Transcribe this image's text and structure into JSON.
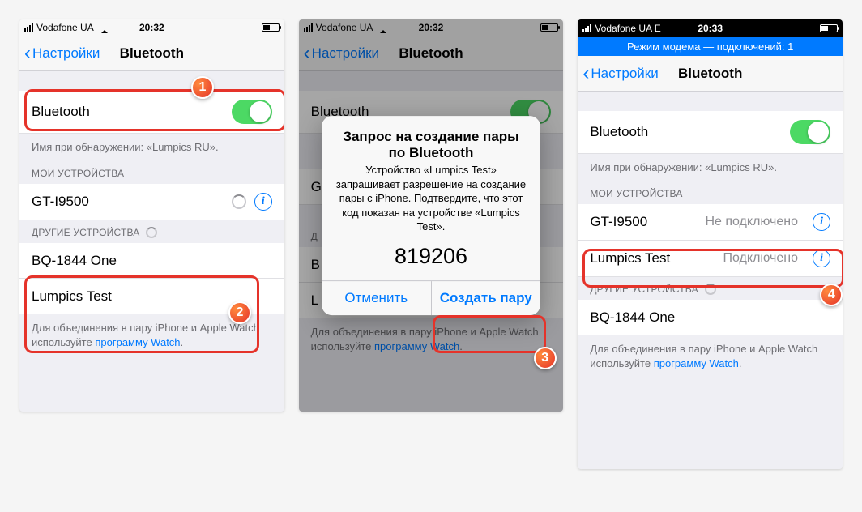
{
  "screen1": {
    "carrier": "Vodafone UA",
    "time": "20:32",
    "back": "Настройки",
    "title": "Bluetooth",
    "bt_label": "Bluetooth",
    "discoverable": "Имя при обнаружении: «Lumpics RU».",
    "my_devices_header": "МОИ УСТРОЙСТВА",
    "my_device": "GT-I9500",
    "other_devices_header": "ДРУГИЕ УСТРОЙСТВА",
    "other_device_1": "BQ-1844 One",
    "other_device_2": "Lumpics Test",
    "footer_a": "Для объединения в пару iPhone и Apple Watch используйте ",
    "footer_link": "программу Watch",
    "footer_b": "."
  },
  "screen2": {
    "carrier": "Vodafone UA",
    "time": "20:32",
    "back": "Настройки",
    "title": "Bluetooth",
    "alert_title": "Запрос на создание пары по Bluetooth",
    "alert_msg": "Устройство «Lumpics Test» запрашивает разрешение на создание пары с iPhone. Подтвердите, что этот код показан на устройстве «Lumpics Test».",
    "alert_code": "819206",
    "alert_cancel": "Отменить",
    "alert_confirm": "Создать пару",
    "footer_a": "Для объединения в пару iPhone и Apple Watch используйте ",
    "footer_link": "программу Watch",
    "footer_b": "."
  },
  "screen3": {
    "carrier": "Vodafone UA  E",
    "time": "20:33",
    "hotspot": "Режим модема — подключений: 1",
    "back": "Настройки",
    "title": "Bluetooth",
    "bt_label": "Bluetooth",
    "discoverable": "Имя при обнаружении: «Lumpics RU».",
    "my_devices_header": "МОИ УСТРОЙСТВА",
    "my_device_1": "GT-I9500",
    "my_device_1_status": "Не подключено",
    "my_device_2": "Lumpics Test",
    "my_device_2_status": "Подключено",
    "other_devices_header": "ДРУГИЕ УСТРОЙСТВА",
    "other_device_1": "BQ-1844 One",
    "footer_a": "Для объединения в пару iPhone и Apple Watch используйте ",
    "footer_link": "программу Watch",
    "footer_b": "."
  }
}
